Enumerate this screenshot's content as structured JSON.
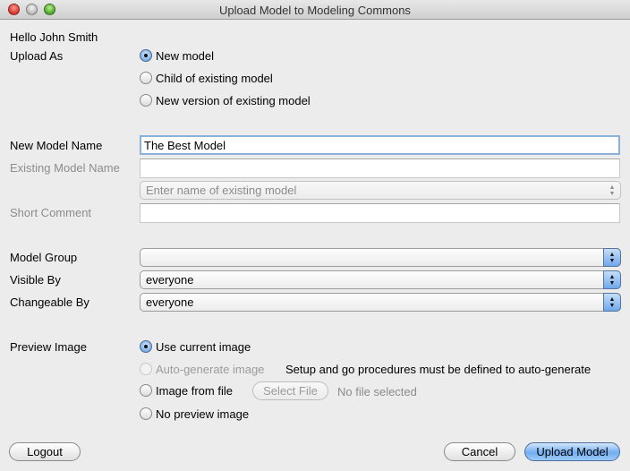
{
  "window": {
    "title": "Upload Model to Modeling Commons"
  },
  "greeting": "Hello John Smith",
  "upload_as": {
    "label": "Upload As",
    "options": [
      {
        "label": "New model",
        "checked": true
      },
      {
        "label": "Child of existing model",
        "checked": false
      },
      {
        "label": "New version of existing model",
        "checked": false
      }
    ]
  },
  "new_model_name": {
    "label": "New Model Name",
    "value": "The Best Model"
  },
  "existing_model_name": {
    "label": "Existing Model Name",
    "value": "",
    "combo_placeholder": "Enter name of existing model"
  },
  "short_comment": {
    "label": "Short Comment",
    "value": ""
  },
  "model_group": {
    "label": "Model Group",
    "value": ""
  },
  "visible_by": {
    "label": "Visible By",
    "value": "everyone"
  },
  "changeable_by": {
    "label": "Changeable By",
    "value": "everyone"
  },
  "preview_image": {
    "label": "Preview Image",
    "options": [
      {
        "label": "Use current image",
        "checked": true,
        "disabled": false
      },
      {
        "label": "Auto-generate image",
        "checked": false,
        "disabled": true
      },
      {
        "label": "Image from file",
        "checked": false,
        "disabled": false
      },
      {
        "label": "No preview image",
        "checked": false,
        "disabled": false
      }
    ],
    "auto_generate_note": "Setup and go procedures must be defined to auto-generate",
    "select_file_label": "Select File",
    "file_status": "No file selected"
  },
  "buttons": {
    "logout": "Logout",
    "cancel": "Cancel",
    "upload": "Upload Model"
  },
  "icons": {
    "combo_arrows": "up-down-arrows-icon",
    "up_arrow": "▲",
    "down_arrow": "▼"
  }
}
